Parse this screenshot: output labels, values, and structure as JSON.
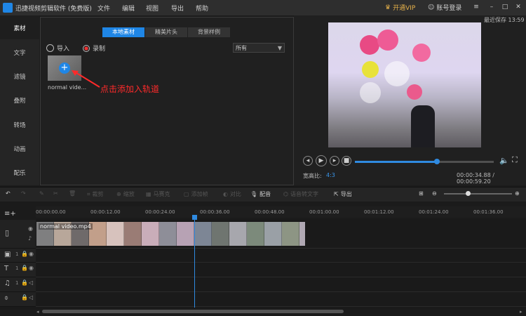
{
  "app": {
    "title": "迅捷视频剪辑软件 (免费版)",
    "menu": [
      "文件",
      "编辑",
      "视图",
      "导出",
      "帮助"
    ],
    "vip_label": "开通VIP",
    "login_label": "账号登录"
  },
  "sidebar": {
    "items": [
      "素材",
      "文字",
      "滤镜",
      "叠附",
      "转场",
      "动画",
      "配乐"
    ],
    "active": "素材"
  },
  "media": {
    "tabs": [
      "本地素材",
      "精美片头",
      "背景样例"
    ],
    "active_tab": "本地素材",
    "import_label": "导入",
    "record_label": "录制",
    "filter_value": "所有",
    "item_label": "normal vide...",
    "hint": "点击添加入轨道"
  },
  "preview": {
    "autosave": "最近保存 13:59",
    "aspect_label": "宽高比:",
    "aspect_value": "4:3",
    "timecode": "00:00:34.88 / 00:00:59.20",
    "progress": 0.59
  },
  "toolbar": {
    "tools": [
      "剪切",
      "裁剪",
      "缩放",
      "马赛克",
      "添加帧",
      "对比",
      "配音",
      "语音转文字",
      "导出"
    ],
    "enabled": [
      "配音",
      "导出"
    ]
  },
  "timeline": {
    "ticks": [
      "00:00:00.00",
      "00:00:12.00",
      "00:00:24.00",
      "00:00:36.00",
      "00:00:48.00",
      "00:01:00.00",
      "00:01:12.00",
      "00:01:24.00",
      "00:01:36.00"
    ],
    "clip_label": "normal video.mp4",
    "zoom_level": 0.35
  },
  "colors": {
    "accent": "#2f8ae0",
    "hint_red": "#ff2a2a",
    "vip_gold": "#e6b14a"
  }
}
